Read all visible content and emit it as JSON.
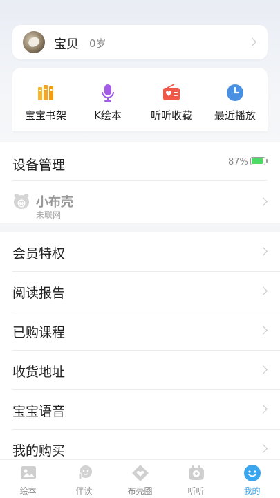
{
  "profile": {
    "name": "宝贝",
    "age": "0岁",
    "avatar_icon": "baby-avatar-photo"
  },
  "quick_actions": [
    {
      "label": "宝宝书架",
      "icon": "bookshelf-icon",
      "color": "#f5a623"
    },
    {
      "label": "K绘本",
      "icon": "microphone-icon",
      "color": "#a35be8"
    },
    {
      "label": "听听收藏",
      "icon": "radio-heart-icon",
      "color": "#f0594a"
    },
    {
      "label": "最近播放",
      "icon": "clock-icon",
      "color": "#4a90e2"
    }
  ],
  "device": {
    "title": "设备管理",
    "battery_text": "87%",
    "battery_level": 0.87,
    "battery_color": "#4cd964",
    "device_name": "小布壳",
    "device_status": "未联网",
    "device_icon": "robot-device-icon"
  },
  "menu": [
    {
      "label": "会员特权"
    },
    {
      "label": "阅读报告"
    },
    {
      "label": "已购课程"
    },
    {
      "label": "收货地址"
    },
    {
      "label": "宝宝语音"
    },
    {
      "label": "我的购买"
    }
  ],
  "tabbar": [
    {
      "label": "绘本",
      "icon": "picture-book-icon",
      "active": false
    },
    {
      "label": "伴读",
      "icon": "companion-reading-icon",
      "active": false
    },
    {
      "label": "布壳圈",
      "icon": "heart-circle-icon",
      "active": false
    },
    {
      "label": "听听",
      "icon": "radio-icon",
      "active": false
    },
    {
      "label": "我的",
      "icon": "smiley-face-icon",
      "active": true
    }
  ],
  "colors": {
    "accent": "#3aa6f0",
    "inactive_tab": "#888888"
  }
}
